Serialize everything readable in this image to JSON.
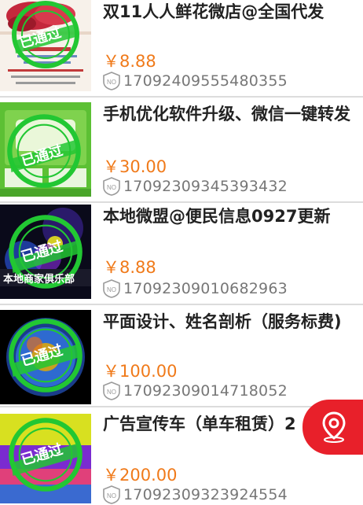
{
  "items": [
    {
      "title": "双11人人鲜花微店@全国代发",
      "price": "￥8.88",
      "code": "17092409555480355",
      "no_badge": "NO",
      "stamp_text": "已通过"
    },
    {
      "title": "手机优化软件升级、微信一键转发",
      "price": "￥30.00",
      "code": "17092309345393432",
      "no_badge": "NO",
      "stamp_text": "已通过"
    },
    {
      "title": "本地微盟@便民信息0927更新",
      "price": "￥8.88",
      "code": "17092309010682963",
      "no_badge": "NO",
      "stamp_text": "已通过"
    },
    {
      "title": "平面设计、姓名剖析（服务标费)",
      "price": "￥100.00",
      "code": "17092309014718052",
      "no_badge": "NO",
      "stamp_text": "已通过"
    },
    {
      "title": "广告宣传车（单车租赁）2",
      "price": "￥200.00",
      "code": "17092309323924554",
      "no_badge": "NO",
      "stamp_text": "已通过"
    }
  ],
  "thumb_text": {
    "item3": "本地商家俱乐部"
  },
  "colors": {
    "price": "#f07a1a",
    "stamp": "#22c733",
    "fab": "#e8202a"
  },
  "fab": {
    "icon": "location-pin-icon"
  }
}
